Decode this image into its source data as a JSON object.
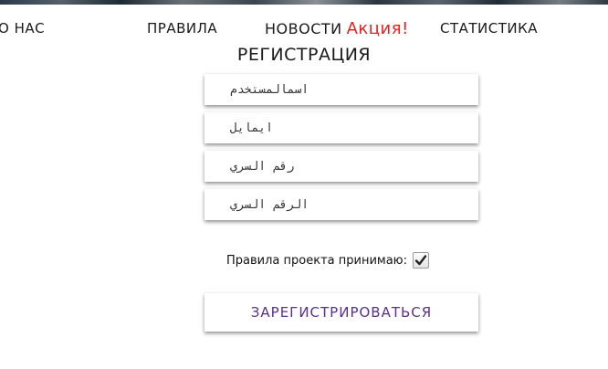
{
  "nav": {
    "about": "О НАС",
    "rules": "ПРАВИЛА",
    "news": "НОВОСТИ",
    "promo": "Акция!",
    "stats": "СТАТИСТИКА",
    "register": "РЕГИСТРАЦИЯ"
  },
  "form": {
    "username_placeholder": "اسمالمستخدم",
    "email_placeholder": "ايمايل",
    "password_placeholder": "رقم السري",
    "password_confirm_placeholder": "الرقم السري"
  },
  "agree": {
    "label": "Правила проекта принимаю:",
    "checked": true
  },
  "submit_label": "ЗАРЕГИСТРИРОВАТЬСЯ",
  "colors": {
    "promo": "#e8201f",
    "submit_text": "#5a2f8f"
  }
}
